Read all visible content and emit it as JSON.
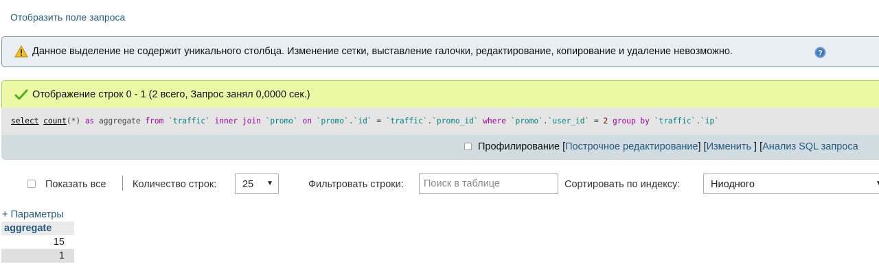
{
  "links": {
    "show_query": "Отобразить поле запроса",
    "parameters": "+ Параметры"
  },
  "notices": {
    "warning": "Данное выделение не содержит уникального столбца. Изменение сетки, выставление галочки, редактирование, копирование и удаление невозможно.",
    "success": "Отображение строк 0 - 1 (2 всего, Запрос занял 0,0000 сек.)"
  },
  "sql": {
    "tokens": [
      {
        "t": "select",
        "c": "fn"
      },
      {
        "t": " ",
        "c": "op"
      },
      {
        "t": "count",
        "c": "fn"
      },
      {
        "t": "(*) ",
        "c": "op"
      },
      {
        "t": "as",
        "c": "kw"
      },
      {
        "t": " aggregate ",
        "c": "op"
      },
      {
        "t": "from",
        "c": "kw"
      },
      {
        "t": " ",
        "c": "op"
      },
      {
        "t": "`traffic`",
        "c": "id"
      },
      {
        "t": " ",
        "c": "op"
      },
      {
        "t": "inner join",
        "c": "kw"
      },
      {
        "t": " ",
        "c": "op"
      },
      {
        "t": "`promo`",
        "c": "id"
      },
      {
        "t": " ",
        "c": "op"
      },
      {
        "t": "on",
        "c": "kw"
      },
      {
        "t": " ",
        "c": "op"
      },
      {
        "t": "`promo`",
        "c": "id"
      },
      {
        "t": ".",
        "c": "op"
      },
      {
        "t": "`id`",
        "c": "id"
      },
      {
        "t": " = ",
        "c": "op"
      },
      {
        "t": "`traffic`",
        "c": "id"
      },
      {
        "t": ".",
        "c": "op"
      },
      {
        "t": "`promo_id`",
        "c": "id"
      },
      {
        "t": " ",
        "c": "op"
      },
      {
        "t": "where",
        "c": "kw"
      },
      {
        "t": " ",
        "c": "op"
      },
      {
        "t": "`promo`",
        "c": "id"
      },
      {
        "t": ".",
        "c": "op"
      },
      {
        "t": "`user_id`",
        "c": "id"
      },
      {
        "t": " = ",
        "c": "op"
      },
      {
        "t": "2",
        "c": "num"
      },
      {
        "t": " ",
        "c": "op"
      },
      {
        "t": "group by",
        "c": "kw"
      },
      {
        "t": " ",
        "c": "op"
      },
      {
        "t": "`traffic`",
        "c": "id"
      },
      {
        "t": ".",
        "c": "op"
      },
      {
        "t": "`ip`",
        "c": "id"
      }
    ]
  },
  "tools": {
    "profiling": "Профилирование",
    "bracket_open": " [",
    "inline_edit": "Построчное редактирование",
    "sep1": "] [",
    "edit": "Изменить",
    "sep2": " ] [",
    "analyze": "Анализ SQL запроса"
  },
  "controls": {
    "show_all": "Показать все",
    "row_count_label": "Количество строк:",
    "row_count_value": "25",
    "filter_label": "Фильтровать строки:",
    "search_placeholder": "Поиск в таблице",
    "sort_label": "Сортировать по индексу:",
    "sort_value": "Ниодного"
  },
  "table": {
    "column": "aggregate",
    "rows": [
      "15",
      "1"
    ]
  },
  "colors": {
    "link": "#235a81",
    "warning_bg": "#e8eef1",
    "success_bg": "#ebf8a4",
    "sql_bg": "#e5e5e5",
    "tools_bg": "#d0dce0"
  }
}
